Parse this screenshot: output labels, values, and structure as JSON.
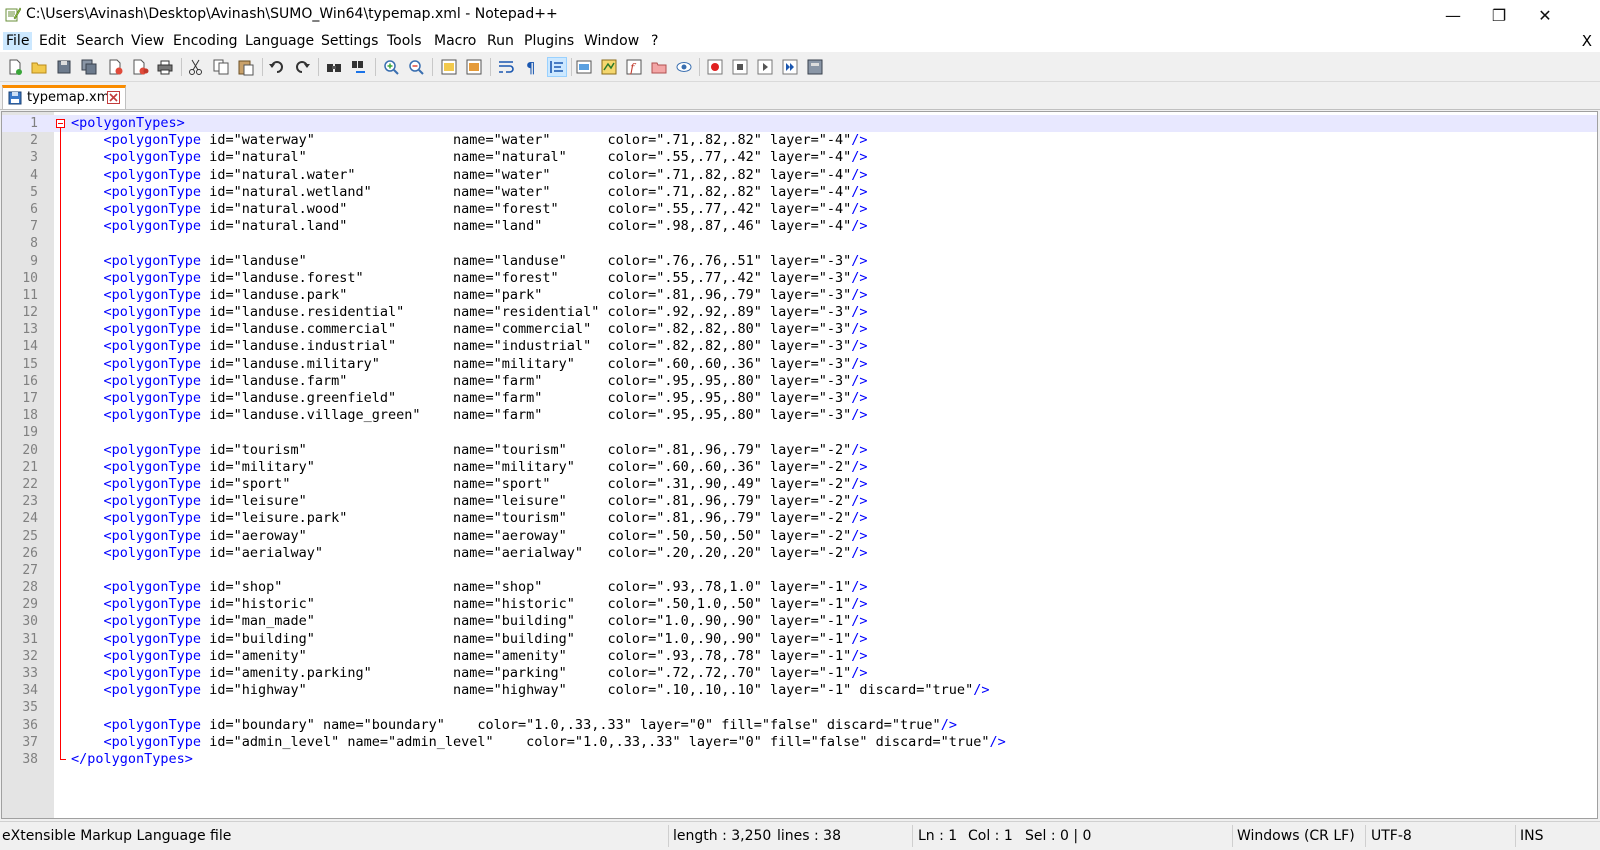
{
  "window": {
    "title": "C:\\Users\\Avinash\\Desktop\\Avinash\\SUMO_Win64\\typemap.xml - Notepad++",
    "minimize_glyph": "—",
    "maximize_glyph": "❐",
    "close_glyph": "✕"
  },
  "menu": {
    "items": [
      "File",
      "Edit",
      "Search",
      "View",
      "Encoding",
      "Language",
      "Settings",
      "Tools",
      "Macro",
      "Run",
      "Plugins",
      "Window",
      "?"
    ],
    "close_doc": "X"
  },
  "toolbar": {
    "icons": [
      "new-file-icon",
      "open-file-icon",
      "save-icon",
      "save-all-icon",
      "close-icon",
      "close-all-icon",
      "print-icon",
      "cut-icon",
      "copy-icon",
      "paste-icon",
      "undo-icon",
      "redo-icon",
      "find-icon",
      "replace-icon",
      "zoom-in-icon",
      "zoom-out-icon",
      "sync-vertical-icon",
      "sync-horizontal-icon",
      "word-wrap-icon",
      "show-all-chars-icon",
      "indent-guide-icon",
      "udl-icon",
      "document-map-icon",
      "function-list-icon",
      "folder-as-workspace-icon",
      "monitoring-icon",
      "record-macro-icon",
      "stop-recording-icon",
      "playback-macro-icon",
      "run-macro-multiple-icon",
      "save-macro-icon"
    ]
  },
  "tab": {
    "label": "typemap.xml"
  },
  "editor": {
    "lines": [
      "<polygonTypes>",
      "    <polygonType id=\"waterway\"                 name=\"water\"       color=\".71,.82,.82\" layer=\"-4\"/>",
      "    <polygonType id=\"natural\"                  name=\"natural\"     color=\".55,.77,.42\" layer=\"-4\"/>",
      "    <polygonType id=\"natural.water\"            name=\"water\"       color=\".71,.82,.82\" layer=\"-4\"/>",
      "    <polygonType id=\"natural.wetland\"          name=\"water\"       color=\".71,.82,.82\" layer=\"-4\"/>",
      "    <polygonType id=\"natural.wood\"             name=\"forest\"      color=\".55,.77,.42\" layer=\"-4\"/>",
      "    <polygonType id=\"natural.land\"             name=\"land\"        color=\".98,.87,.46\" layer=\"-4\"/>",
      "",
      "    <polygonType id=\"landuse\"                  name=\"landuse\"     color=\".76,.76,.51\" layer=\"-3\"/>",
      "    <polygonType id=\"landuse.forest\"           name=\"forest\"      color=\".55,.77,.42\" layer=\"-3\"/>",
      "    <polygonType id=\"landuse.park\"             name=\"park\"        color=\".81,.96,.79\" layer=\"-3\"/>",
      "    <polygonType id=\"landuse.residential\"      name=\"residential\" color=\".92,.92,.89\" layer=\"-3\"/>",
      "    <polygonType id=\"landuse.commercial\"       name=\"commercial\"  color=\".82,.82,.80\" layer=\"-3\"/>",
      "    <polygonType id=\"landuse.industrial\"       name=\"industrial\"  color=\".82,.82,.80\" layer=\"-3\"/>",
      "    <polygonType id=\"landuse.military\"         name=\"military\"    color=\".60,.60,.36\" layer=\"-3\"/>",
      "    <polygonType id=\"landuse.farm\"             name=\"farm\"        color=\".95,.95,.80\" layer=\"-3\"/>",
      "    <polygonType id=\"landuse.greenfield\"       name=\"farm\"        color=\".95,.95,.80\" layer=\"-3\"/>",
      "    <polygonType id=\"landuse.village_green\"    name=\"farm\"        color=\".95,.95,.80\" layer=\"-3\"/>",
      "",
      "    <polygonType id=\"tourism\"                  name=\"tourism\"     color=\".81,.96,.79\" layer=\"-2\"/>",
      "    <polygonType id=\"military\"                 name=\"military\"    color=\".60,.60,.36\" layer=\"-2\"/>",
      "    <polygonType id=\"sport\"                    name=\"sport\"       color=\".31,.90,.49\" layer=\"-2\"/>",
      "    <polygonType id=\"leisure\"                  name=\"leisure\"     color=\".81,.96,.79\" layer=\"-2\"/>",
      "    <polygonType id=\"leisure.park\"             name=\"tourism\"     color=\".81,.96,.79\" layer=\"-2\"/>",
      "    <polygonType id=\"aeroway\"                  name=\"aeroway\"     color=\".50,.50,.50\" layer=\"-2\"/>",
      "    <polygonType id=\"aerialway\"                name=\"aerialway\"   color=\".20,.20,.20\" layer=\"-2\"/>",
      "",
      "    <polygonType id=\"shop\"                     name=\"shop\"        color=\".93,.78,1.0\" layer=\"-1\"/>",
      "    <polygonType id=\"historic\"                 name=\"historic\"    color=\".50,1.0,.50\" layer=\"-1\"/>",
      "    <polygonType id=\"man_made\"                 name=\"building\"    color=\"1.0,.90,.90\" layer=\"-1\"/>",
      "    <polygonType id=\"building\"                 name=\"building\"    color=\"1.0,.90,.90\" layer=\"-1\"/>",
      "    <polygonType id=\"amenity\"                  name=\"amenity\"     color=\".93,.78,.78\" layer=\"-1\"/>",
      "    <polygonType id=\"amenity.parking\"          name=\"parking\"     color=\".72,.72,.70\" layer=\"-1\"/>",
      "    <polygonType id=\"highway\"                  name=\"highway\"     color=\".10,.10,.10\" layer=\"-1\" discard=\"true\"/>",
      "",
      "    <polygonType id=\"boundary\" name=\"boundary\"    color=\"1.0,.33,.33\" layer=\"0\" fill=\"false\" discard=\"true\"/>",
      "    <polygonType id=\"admin_level\" name=\"admin_level\"    color=\"1.0,.33,.33\" layer=\"0\" fill=\"false\" discard=\"true\"/>",
      "</polygonTypes>"
    ]
  },
  "status": {
    "file_type": "eXtensible Markup Language file",
    "length": "length : 3,250",
    "lines": "lines : 38",
    "ln": "Ln : 1",
    "col": "Col : 1",
    "sel": "Sel : 0 | 0",
    "eol": "Windows (CR LF)",
    "encoding": "UTF-8",
    "mode": "INS"
  },
  "colors": {
    "tag": "#0000ff",
    "attr": "#ff0000",
    "value": "#8000ff",
    "tab_accent": "#fa8c00",
    "current_line": "#e8e8ff"
  }
}
